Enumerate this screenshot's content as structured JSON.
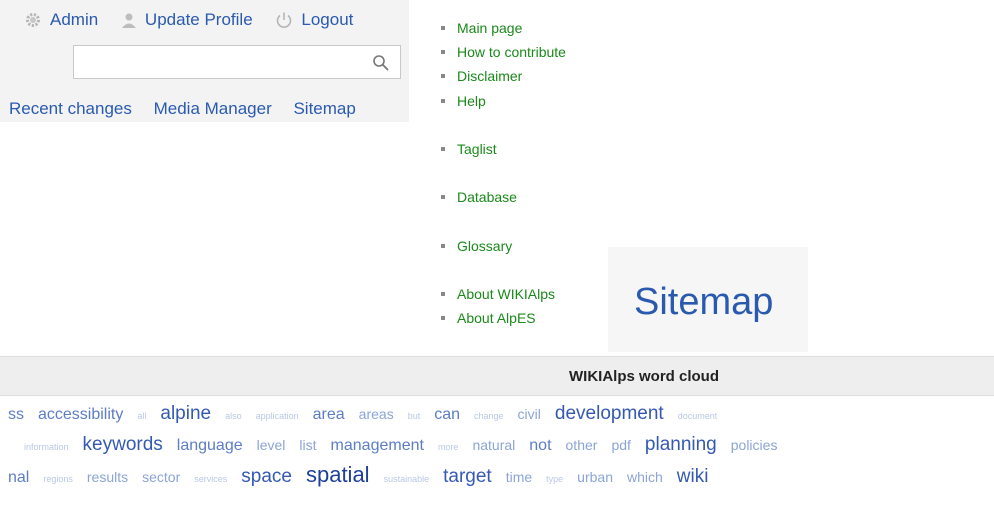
{
  "userbar": {
    "admin": "Admin",
    "update_profile": "Update Profile",
    "logout": "Logout"
  },
  "search": {
    "placeholder": ""
  },
  "toolbar": {
    "recent_changes": "Recent changes",
    "media_manager": "Media Manager",
    "sitemap": "Sitemap"
  },
  "nav": {
    "main_page": "Main page",
    "how_to_contribute": "How to contribute",
    "disclaimer": "Disclaimer",
    "help": "Help",
    "taglist": "Taglist",
    "database": "Database",
    "glossary": "Glossary",
    "about_wikialps": "About WIKIAlps",
    "about_alpes": "About AlpES"
  },
  "page_title": "Sitemap",
  "word_cloud": {
    "title": "WIKIAlps word cloud",
    "row1": [
      "ss",
      "accessibility",
      "all",
      "alpine",
      "also",
      "application",
      "area",
      "areas",
      "but",
      "can",
      "change",
      "civil",
      "development",
      "document"
    ],
    "row2": [
      "information",
      "keywords",
      "language",
      "level",
      "list",
      "management",
      "more",
      "natural",
      "not",
      "other",
      "pdf",
      "planning",
      "policies"
    ],
    "row3": [
      "nal",
      "regions",
      "results",
      "sector",
      "services",
      "space",
      "spatial",
      "sustainable",
      "target",
      "time",
      "type",
      "urban",
      "which",
      "wiki"
    ],
    "row1_sizes": [
      3,
      3,
      1,
      4,
      1,
      1,
      3,
      2,
      1,
      3,
      1,
      2,
      4,
      1
    ],
    "row2_sizes": [
      1,
      4,
      3,
      2,
      2,
      3,
      1,
      2,
      3,
      2,
      2,
      4,
      2
    ],
    "row3_sizes": [
      3,
      1,
      2,
      2,
      1,
      4,
      5,
      1,
      4,
      2,
      1,
      2,
      2,
      4
    ]
  },
  "colors": {
    "link_blue": "#2a5ab0",
    "nav_green": "#1a8a1a"
  }
}
